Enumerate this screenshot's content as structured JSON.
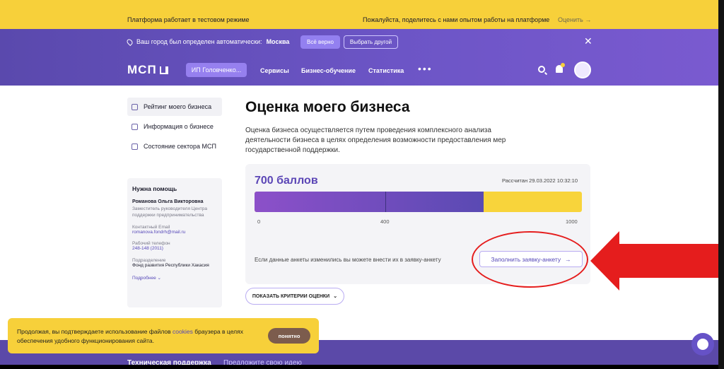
{
  "topbar": {
    "notice": "Платформа работает в тестовом режиме",
    "feedback": "Пожалуйста, поделитесь с нами опытом работы на платформе",
    "rate_label": "Оценить →"
  },
  "city_bar": {
    "text": "Ваш город был определен автоматически:",
    "city": "Москва",
    "confirm_label": "Всё верно",
    "change_label": "Выбрать другой",
    "close_glyph": "✕"
  },
  "header": {
    "logo": "МСП",
    "account": "ИП Головченко...",
    "nav": [
      "Сервисы",
      "Бизнес-обучение",
      "Статистика"
    ],
    "more": "•••"
  },
  "sidebar": {
    "items": [
      {
        "label": "Рейтинг моего бизнеса",
        "icon": "bar-chart-icon"
      },
      {
        "label": "Информация о бизнесе",
        "icon": "briefcase-icon"
      },
      {
        "label": "Состояние сектора МСП",
        "icon": "sector-icon"
      }
    ]
  },
  "help": {
    "title": "Нужна помощь",
    "name": "Романова Ольга Викторовна",
    "position": "Заместитель руководителя Центра поддержки предпринимательства",
    "email_label": "Контактный Email",
    "email": "romanova.fondrh@mail.ru",
    "phone_label": "Рабочий телефон",
    "phone": "248-148 (2011)",
    "dept_label": "Подразделение",
    "dept": "Фонд развития Республики Хакасия",
    "more": "Подробнее ⌄"
  },
  "main": {
    "title": "Оценка моего бизнеса",
    "description": "Оценка бизнеса осуществляется путем проведения комплексного анализа деятельности бизнеса в целях определения возможности предоставления мер государственной поддержки.",
    "score_label": "700 баллов",
    "calculated": "Рассчитан 29.03.2022 10:32:10",
    "score_value": 700,
    "score_max": 1000,
    "threshold": 400,
    "ticks": [
      "0",
      "400",
      "1000"
    ],
    "note": "Если данные анкеты изменились вы можете внести их в заявку-анкету",
    "fill_button": "Заполнить заявку-анкету",
    "criteria_button": "ПОКАЗАТЬ КРИТЕРИИ ОЦЕНКИ"
  },
  "cookie": {
    "text_before": "Продолжая, вы подтверждаете использование файлов",
    "link": "cookies",
    "text_after": "браузера в целях обеспечения удобного функционирования сайта.",
    "ok": "понятно"
  },
  "footer": {
    "support": "Техническая поддержка",
    "suggest": "Предложите свою идею"
  },
  "colors": {
    "accent": "#5b46b6",
    "yellow": "#f7d03a",
    "annotation": "#e51d1d"
  }
}
